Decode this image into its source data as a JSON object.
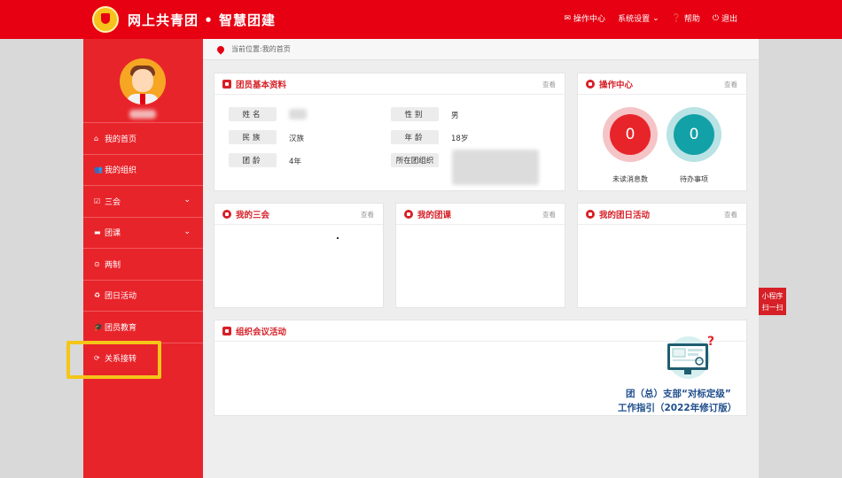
{
  "header": {
    "site_title": "网上共青团 • 智慧团建",
    "nav": [
      {
        "label": "操作中心",
        "icon": "envelope-icon"
      },
      {
        "label": "系统设置",
        "icon": "chevron-down-icon"
      },
      {
        "label": "帮助",
        "icon": "question-icon"
      },
      {
        "label": "退出",
        "icon": "power-icon"
      }
    ]
  },
  "sidebar": {
    "items": [
      {
        "label": "我的首页",
        "icon": "home-icon"
      },
      {
        "label": "我的组织",
        "icon": "users-icon"
      },
      {
        "label": "三会",
        "icon": "checkbox-icon",
        "expandable": true
      },
      {
        "label": "团课",
        "icon": "folder-icon",
        "expandable": true
      },
      {
        "label": "两制",
        "icon": "circle-icon"
      },
      {
        "label": "团日活动",
        "icon": "recycle-icon"
      },
      {
        "label": "团员教育",
        "icon": "graduation-icon"
      },
      {
        "label": "关系接转",
        "icon": "refresh-icon"
      }
    ]
  },
  "breadcrumb": "当前位置:我的首页",
  "profile": {
    "title": "团员基本资料",
    "more": "查看",
    "fields": [
      {
        "label": "姓名",
        "value": ""
      },
      {
        "label": "性别",
        "value": "男"
      },
      {
        "label": "民族",
        "value": "汉族"
      },
      {
        "label": "年龄",
        "value": "18岁"
      },
      {
        "label": "团龄",
        "value": "4年"
      },
      {
        "label": "所在团组织",
        "value": ""
      }
    ]
  },
  "ops": {
    "title": "操作中心",
    "more": "查看",
    "unread_count": "0",
    "unread_label": "未读消息数",
    "todo_count": "0",
    "todo_label": "待办事项",
    "colors": {
      "unread": "#e8242b",
      "todo": "#13a1a8"
    }
  },
  "panels": {
    "sanhui": {
      "title": "我的三会",
      "more": "查看"
    },
    "tuanke": {
      "title": "我的团课",
      "more": "查看"
    },
    "tuanri": {
      "title": "我的团日活动",
      "more": "查看"
    },
    "meeting": {
      "title": "组织会议活动"
    }
  },
  "promo": {
    "line1": "团（总）支部“对标定级”",
    "line2": "工作指引（2022年修订版）"
  },
  "mini_program": {
    "line1": "小程序",
    "line2": "扫一扫"
  }
}
